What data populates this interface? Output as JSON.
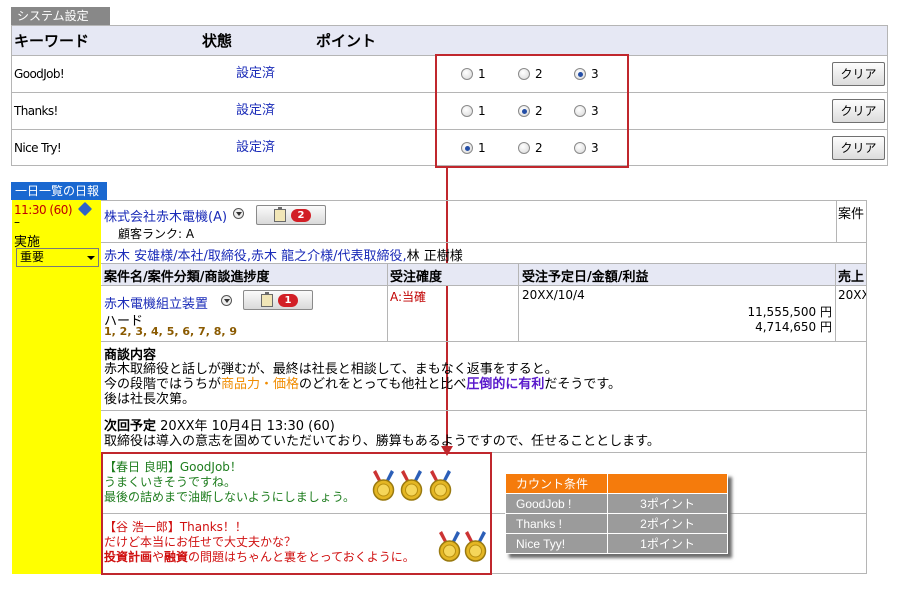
{
  "system_settings": {
    "tab_label": "システム設定",
    "headers": {
      "keyword": "キーワード",
      "status": "状態",
      "point": "ポイント"
    },
    "rows": [
      {
        "keyword": "GoodJob!",
        "status": "設定済",
        "options": [
          "1",
          "2",
          "3"
        ],
        "selected": "3",
        "clear_label": "クリア"
      },
      {
        "keyword": "Thanks!",
        "status": "設定済",
        "options": [
          "1",
          "2",
          "3"
        ],
        "selected": "2",
        "clear_label": "クリア"
      },
      {
        "keyword": "Nice Try!",
        "status": "設定済",
        "options": [
          "1",
          "2",
          "3"
        ],
        "selected": "1",
        "clear_label": "クリア"
      }
    ]
  },
  "report": {
    "tab_label": "一日一覧の日報",
    "left": {
      "time": "11:30 (60)",
      "dash": "–",
      "status": "実施",
      "priority": "重要"
    },
    "company": {
      "name": "株式会社赤木電機(A)",
      "badge_count": "2",
      "rank": "顧客ランク: A",
      "right_label": "案件"
    },
    "contacts": {
      "linked": "赤木 安雄様/本社/取締役,赤木 龍之介様/代表取締役,",
      "plain": "林 正樹様"
    },
    "headers": {
      "project": "案件名/案件分類/商談進捗度",
      "confirm": "受注確度",
      "date_amount": "受注予定日/金額/利益",
      "sales": "売上"
    },
    "project": {
      "name": "赤木電機組立装置",
      "badge_count": "1",
      "category": "ハード",
      "progress": [
        "1",
        "2",
        "3",
        "4",
        "5",
        "6",
        "7",
        "8",
        "9"
      ],
      "confirm": "A:当確",
      "date": "20XX/10/4",
      "amount": "11,555,500 円",
      "profit": "4,714,650 円",
      "sales": "20XX"
    },
    "meeting": {
      "title": "商談内容",
      "line1": "赤木取締役と話しが弾むが、最終は社長と相談して、まもなく返事をすると。",
      "line2_a": "今の段階ではうちが",
      "line2_b": "商品力・価格",
      "line2_c": "のどれをとっても他社と比べ",
      "line2_d": "圧倒的に有利",
      "line2_e": "だそうです。",
      "line3": "後は社長次第。"
    },
    "next": {
      "title": "次回予定",
      "when": "20XX年 10月4日 13:30 (60)",
      "text": "取締役は導入の意志を固めていただいており、勝算もあるようですので、任せることとします。"
    },
    "comments": [
      {
        "header": "【春日 良明】GoodJob！",
        "line1": "うまくいきそうですね。",
        "line2": "最後の詰めまで油断しないようにしましょう。",
        "medals": 3
      },
      {
        "header": "【谷 浩一郎】Thanks！！",
        "line1": "だけど本当にお任せで大丈夫かな？",
        "line2_a": "投資計画",
        "line2_b": "や",
        "line2_c": "融資",
        "line2_d": "の問題はちゃんと裏をとっておくように。",
        "medals": 2
      }
    ],
    "count_table": {
      "header": "カウント条件",
      "rows": [
        {
          "keyword": "GoodJob !",
          "points": "3ポイント"
        },
        {
          "keyword": "Thanks !",
          "points": "2ポイント"
        },
        {
          "keyword": "Nice Tyy!",
          "points": "1ポイント"
        }
      ]
    }
  },
  "colors": {
    "accent_red": "#c0272d",
    "link_blue": "#1a2bb8",
    "highlight_yellow": "#ffff00",
    "orange_text": "#f08c00",
    "purple_text": "#5a1acc",
    "table_orange": "#f57b0c"
  }
}
